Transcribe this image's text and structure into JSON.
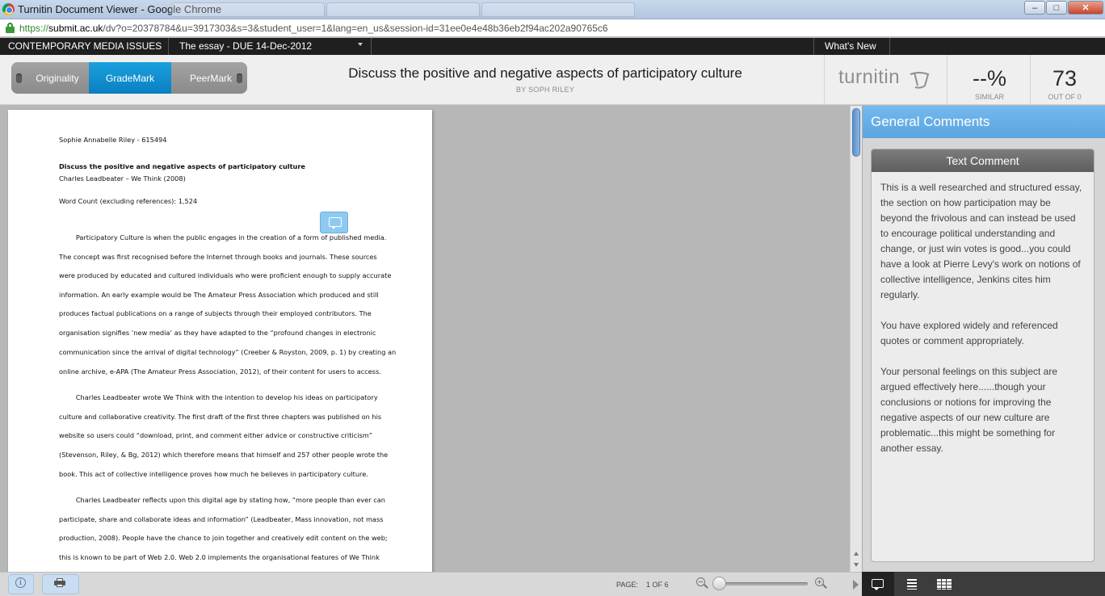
{
  "browser": {
    "window_title": "Turnitin Document Viewer - Google Chrome",
    "url_scheme": "https://",
    "url_host": "submit.ac.uk",
    "url_path": "/dv?o=20378784&u=3917303&s=3&student_user=1&lang=en_us&session-id=31ee0e4e48b36eb2f94ac202a90765c6"
  },
  "nav": {
    "course": "CONTEMPORARY MEDIA ISSUES",
    "assignment": "The essay - DUE 14-Dec-2012",
    "whats_new": "What's New"
  },
  "modes": {
    "originality": "Originality",
    "grademark": "GradeMark",
    "peermark": "PeerMark",
    "active": "GradeMark"
  },
  "header": {
    "title": "Discuss the positive and negative aspects of participatory culture",
    "author": "BY SOPH RILEY",
    "logo": "turnitin",
    "similarity_value": "--%",
    "similarity_label": "SIMILAR",
    "score_value": "73",
    "score_label": "OUT OF 0"
  },
  "document": {
    "student_line": "Sophie Annabelle Riley - 615494",
    "heading": "Discuss the positive and negative aspects of participatory culture",
    "subheading": "Charles Leadbeater – We Think (2008)",
    "word_count": "Word Count (excluding references): 1,524",
    "lines": [
      "        Participatory Culture is when the public engages in the creation of a form of published media.",
      "The concept was first recognised before the Internet through books and journals. These sources",
      "were produced by educated and cultured individuals who were proficient enough to supply accurate",
      "information. An early example would be The Amateur Press Association which produced and still",
      "produces factual publications on a range of subjects through their employed contributors. The",
      "organisation signifies ‘new media’ as they have adapted to the “profound changes in electronic",
      "communication since the arrival of digital technology” (Creeber & Royston, 2009, p. 1) by creating an",
      "online archive, e-APA (The Amateur Press Association, 2012), of their content for users to access.",
      "        Charles Leadbeater wrote We Think with the intention to develop his ideas on participatory",
      "culture and collaborative creativity. The first draft of the first three chapters was published on his",
      "website so users could “download, print, and comment either advice or constructive criticism”",
      "(Stevenson, Riley, & Bg, 2012) which therefore means that himself and 257 other people wrote the",
      "book. This act of collective intelligence proves how much he believes in participatory culture.",
      "        Charles Leadbeater reflects upon this digital age by stating how, “more people than ever can",
      "participate, share and collaborate ideas and information” (Leadbeater, Mass innovation, not mass",
      "production, 2008). People have the chance to join together and creatively edit content on the web;",
      "this is known to be part of Web 2.0. Web 2.0 implements the organisational features of We Think"
    ]
  },
  "panel": {
    "title": "General Comments",
    "card_title": "Text Comment",
    "paragraphs": [
      "This is a well researched and structured essay, the section on how participation may be beyond the frivolous and can instead be used to encourage political understanding and change, or just win votes is good...you could have a look at Pierre Levy's work on notions of collective intelligence, Jenkins cites him regularly.",
      "You have explored widely and referenced quotes or comment appropriately.",
      "Your personal feelings on this subject are argued effectively here......though your conclusions or notions for improving the negative aspects of our new culture are problematic...this might be something for another essay."
    ]
  },
  "footer": {
    "page_label": "PAGE:",
    "page_count": "1 OF 6"
  }
}
